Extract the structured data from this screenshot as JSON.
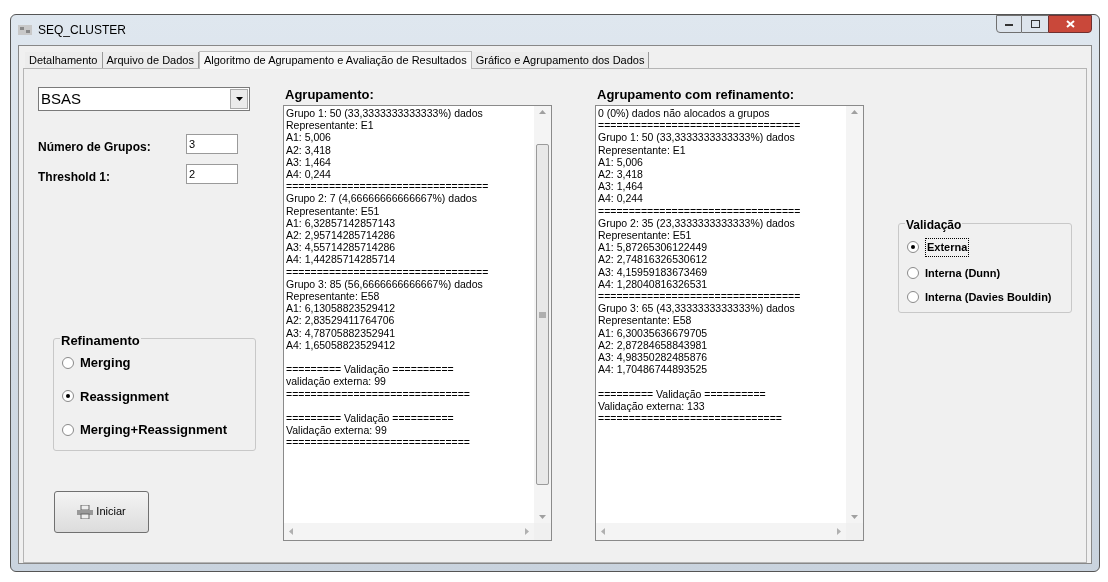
{
  "window": {
    "title": "SEQ_CLUSTER"
  },
  "tabs": [
    {
      "label": "Detalhamento",
      "selected": false
    },
    {
      "label": "Arquivo de Dados",
      "selected": false
    },
    {
      "label": "Algoritmo de Agrupamento e Avaliação de Resultados",
      "selected": true
    },
    {
      "label": "Gráfico e Agrupamento dos Dados",
      "selected": false
    }
  ],
  "algorithm_select": {
    "value": "BSAS"
  },
  "fields": [
    {
      "label": "Número de Grupos:",
      "value": "3"
    },
    {
      "label": "Threshold 1:",
      "value": "2"
    }
  ],
  "refinamento": {
    "title": "Refinamento",
    "options": [
      {
        "label": "Merging",
        "selected": false
      },
      {
        "label": "Reassignment",
        "selected": true
      },
      {
        "label": "Merging+Reassignment",
        "selected": false
      }
    ]
  },
  "start_button": {
    "label": "Iniciar"
  },
  "results": [
    {
      "heading": "Agrupamento:",
      "scroll_thumb": true,
      "lines": [
        {
          "text": "Grupo 1: 50 (33,3333333333333%) dados"
        },
        {
          "text": "Representante: E1"
        },
        {
          "text": "A1: 5,006"
        },
        {
          "text": "A2: 3,418"
        },
        {
          "text": "A3: 1,464"
        },
        {
          "text": "A4: 0,244"
        },
        {
          "text": "================================="
        },
        {
          "text": "Grupo 2: 7 (4,66666666666667%) dados"
        },
        {
          "text": "Representante: E51"
        },
        {
          "text": "A1: 6,32857142857143"
        },
        {
          "text": "A2: 2,95714285714286"
        },
        {
          "text": "A3: 4,55714285714286"
        },
        {
          "text": "A4: 1,44285714285714"
        },
        {
          "text": "================================="
        },
        {
          "text": "Grupo 3: 85 (56,6666666666667%) dados"
        },
        {
          "text": "Representante: E58"
        },
        {
          "text": "A1: 6,13058823529412"
        },
        {
          "text": "A2: 2,83529411764706"
        },
        {
          "text": "A3: 4,78705882352941"
        },
        {
          "text": "A4: 1,65058823529412"
        },
        {
          "text": "========= Validação ==========",
          "gap_before": true
        },
        {
          "text": "validação externa: 99"
        },
        {
          "text": "=============================="
        },
        {
          "text": "========= Validação ==========",
          "gap_before": true
        },
        {
          "text": "Validação externa: 99"
        },
        {
          "text": "=============================="
        }
      ]
    },
    {
      "heading": "Agrupamento com refinamento:",
      "scroll_thumb": false,
      "lines": [
        {
          "text": "0 (0%) dados não alocados a grupos"
        },
        {
          "text": "================================="
        },
        {
          "text": "Grupo 1: 50 (33,3333333333333%) dados"
        },
        {
          "text": "Representante: E1"
        },
        {
          "text": "A1: 5,006"
        },
        {
          "text": "A2: 3,418"
        },
        {
          "text": "A3: 1,464"
        },
        {
          "text": "A4: 0,244"
        },
        {
          "text": "================================="
        },
        {
          "text": "Grupo 2: 35 (23,3333333333333%) dados"
        },
        {
          "text": "Representante: E51"
        },
        {
          "text": "A1: 5,87265306122449"
        },
        {
          "text": "A2: 2,74816326530612"
        },
        {
          "text": "A3: 4,15959183673469"
        },
        {
          "text": "A4: 1,28040816326531"
        },
        {
          "text": "================================="
        },
        {
          "text": "Grupo 3: 65 (43,3333333333333%) dados"
        },
        {
          "text": "Representante: E58"
        },
        {
          "text": "A1: 6,30035636679705"
        },
        {
          "text": "A2: 2,87284658843981"
        },
        {
          "text": "A3: 4,98350282485876"
        },
        {
          "text": "A4: 1,70486744893525"
        },
        {
          "text": "========= Validação ==========",
          "gap_before": true
        },
        {
          "text": "Validação externa: 133"
        },
        {
          "text": "=============================="
        }
      ]
    }
  ],
  "validacao": {
    "title": "Validação",
    "options": [
      {
        "label": "Externa",
        "selected": true
      },
      {
        "label": "Interna (Dunn)",
        "selected": false
      },
      {
        "label": "Interna (Davies Bouldin)",
        "selected": false
      }
    ]
  }
}
